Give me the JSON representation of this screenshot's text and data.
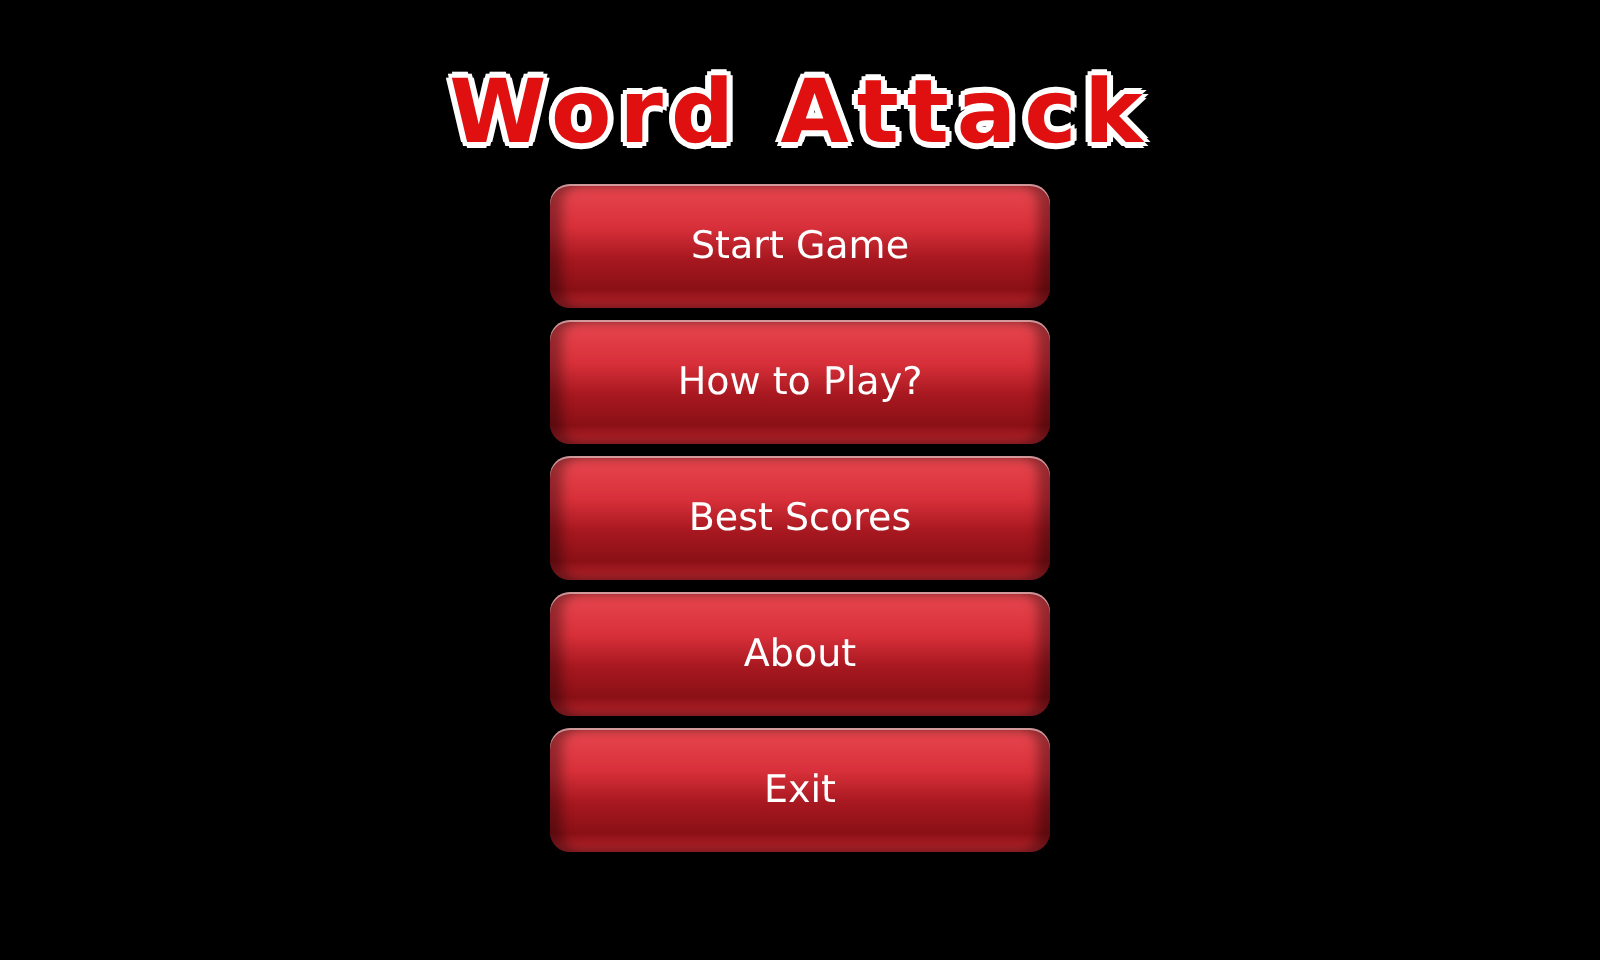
{
  "title": "Word Attack",
  "menu": [
    "Start Game",
    "How to Play?",
    "Best Scores",
    "About",
    "Exit"
  ]
}
